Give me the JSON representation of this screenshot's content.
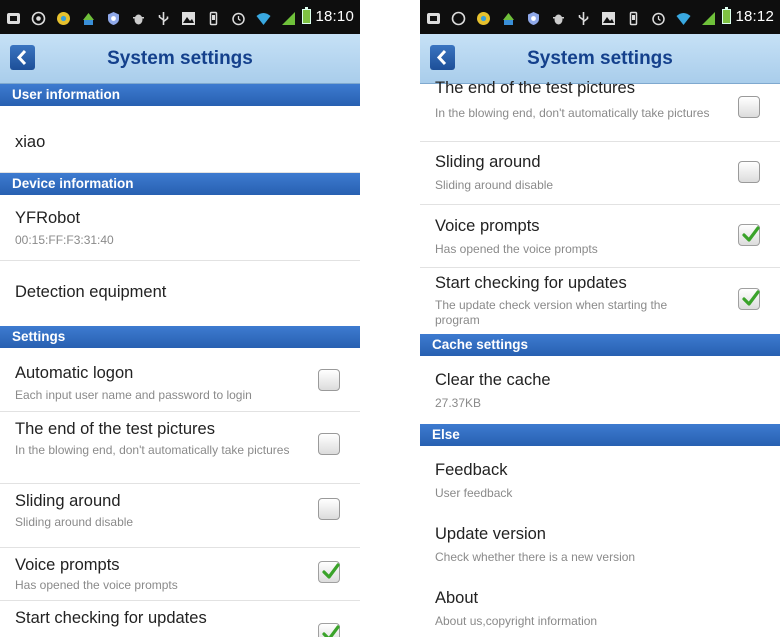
{
  "colors": {
    "title_text": "#14408c",
    "section_bg": "#2a64b6",
    "titlebar_bg": "#bcdaf2",
    "check_green": "#3aa32a"
  },
  "left": {
    "status": {
      "time": "18:10",
      "icons": [
        "notification-icon",
        "target-icon",
        "sync-icon",
        "android-icon",
        "shield-icon",
        "bug-icon",
        "usb-icon",
        "image-icon",
        "vibrate-icon",
        "alarm-icon",
        "wifi-icon",
        "signal-icon",
        "battery-icon"
      ]
    },
    "title": "System settings",
    "sections": {
      "user": "User information",
      "device": "Device information",
      "settings": "Settings"
    },
    "user_name": "xiao",
    "device": {
      "name": "YFRobot",
      "mac": "00:15:FF:F3:31:40",
      "detect": "Detection equipment"
    },
    "settings": [
      {
        "title": "Automatic logon",
        "subtitle": "Each input user name and password to login",
        "checked": false
      },
      {
        "title": "The end of the test pictures",
        "subtitle": "In the blowing end, don't automatically take pictures",
        "checked": false
      },
      {
        "title": "Sliding around",
        "subtitle": "Sliding around disable",
        "checked": false
      },
      {
        "title": "Voice prompts",
        "subtitle": "Has opened the voice prompts",
        "checked": true
      },
      {
        "title": "Start checking for updates",
        "subtitle": "The update check version when starting the program",
        "checked": true
      }
    ]
  },
  "right": {
    "status": {
      "time": "18:12"
    },
    "title": "System settings",
    "settings": [
      {
        "title": "The end of the test pictures",
        "subtitle": "In the blowing end, don't automatically take pictures",
        "checked": false
      },
      {
        "title": "Sliding around",
        "subtitle": "Sliding around disable",
        "checked": false
      },
      {
        "title": "Voice prompts",
        "subtitle": "Has opened the voice prompts",
        "checked": true
      },
      {
        "title": "Start checking for updates",
        "subtitle": "The update check version when starting the program",
        "checked": true
      }
    ],
    "sections": {
      "cache": "Cache settings",
      "else": "Else"
    },
    "cache": {
      "title": "Clear the cache",
      "size": "27.37KB"
    },
    "else_items": [
      {
        "title": "Feedback",
        "subtitle": "User feedback"
      },
      {
        "title": "Update version",
        "subtitle": "Check whether there is a new version"
      },
      {
        "title": "About",
        "subtitle": "About us,copyright information"
      }
    ]
  }
}
